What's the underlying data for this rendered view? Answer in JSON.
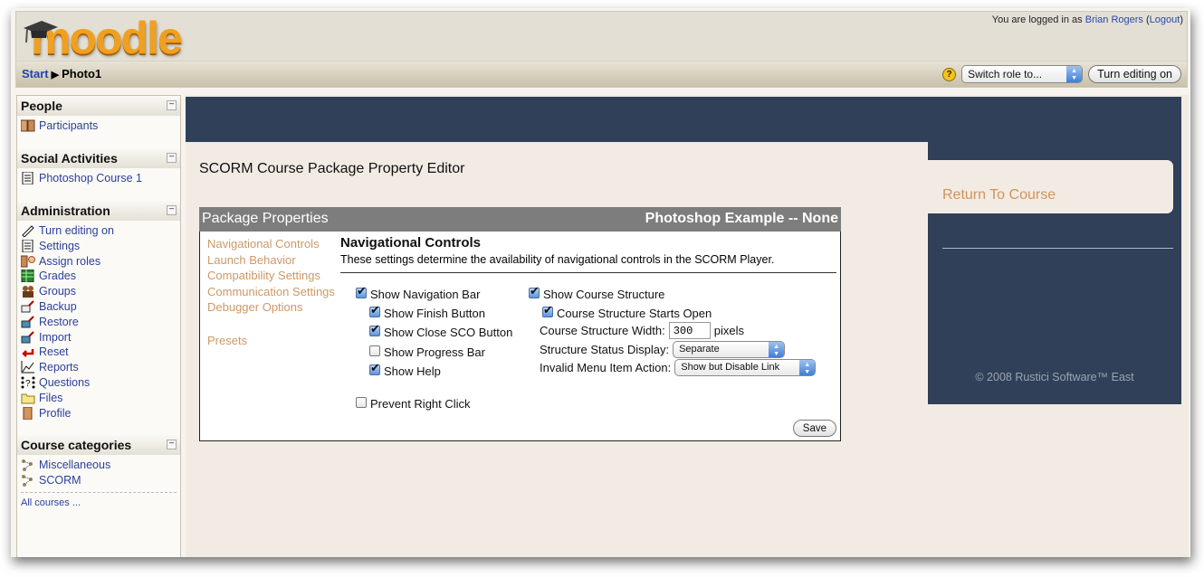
{
  "header": {
    "logo_text": "moodle",
    "login_prefix": "You are logged in as",
    "user_name": "Brian Rogers",
    "logout_label": "Logout"
  },
  "navbar": {
    "breadcrumb": [
      {
        "label": "Start",
        "link": true
      },
      {
        "label": "Photo1",
        "link": false
      }
    ],
    "separator": "▶",
    "help_icon": "?",
    "switch_role": {
      "selected": "Switch role to..."
    },
    "editing_button": "Turn editing on"
  },
  "sidebar": {
    "blocks": [
      {
        "title": "People",
        "items": [
          {
            "label": "Participants",
            "icon": "participants-icon"
          }
        ]
      },
      {
        "title": "Social Activities",
        "items": [
          {
            "label": "Photoshop Course 1",
            "icon": "document-icon"
          }
        ]
      },
      {
        "title": "Administration",
        "items": [
          {
            "label": "Turn editing on",
            "icon": "edit-icon"
          },
          {
            "label": "Settings",
            "icon": "settings-icon"
          },
          {
            "label": "Assign roles",
            "icon": "roles-icon"
          },
          {
            "label": "Grades",
            "icon": "grades-icon"
          },
          {
            "label": "Groups",
            "icon": "groups-icon"
          },
          {
            "label": "Backup",
            "icon": "backup-icon"
          },
          {
            "label": "Restore",
            "icon": "restore-icon"
          },
          {
            "label": "Import",
            "icon": "import-icon"
          },
          {
            "label": "Reset",
            "icon": "reset-icon"
          },
          {
            "label": "Reports",
            "icon": "reports-icon"
          },
          {
            "label": "Questions",
            "icon": "questions-icon"
          },
          {
            "label": "Files",
            "icon": "folder-icon"
          },
          {
            "label": "Profile",
            "icon": "profile-icon"
          }
        ]
      },
      {
        "title": "Course categories",
        "items": [
          {
            "label": "Miscellaneous",
            "icon": "category-icon"
          },
          {
            "label": "SCORM",
            "icon": "category-icon"
          }
        ],
        "footer_link": "All courses ..."
      }
    ]
  },
  "main": {
    "page_title": "SCORM Course Package Property Editor",
    "package": {
      "header_left": "Package Properties",
      "header_right": "Photoshop Example -- None",
      "nav": [
        "Navigational Controls",
        "Launch Behavior",
        "Compatibility Settings",
        "Communication Settings",
        "Debugger Options",
        "Presets"
      ],
      "pane_title": "Navigational Controls",
      "pane_desc": "These settings determine the availability of navigational controls in the SCORM Player.",
      "left_options": [
        {
          "label": "Show Navigation Bar",
          "checked": true
        },
        {
          "label": "Show Finish Button",
          "checked": true
        },
        {
          "label": "Show Close SCO Button",
          "checked": true
        },
        {
          "label": "Show Progress Bar",
          "checked": false
        },
        {
          "label": "Show Help",
          "checked": true
        },
        {
          "label": "Prevent Right Click",
          "checked": false
        }
      ],
      "right_options": [
        {
          "label": "Show Course Structure",
          "checked": true
        },
        {
          "label": "Course Structure Starts Open",
          "checked": true
        }
      ],
      "width_label": "Course Structure Width:",
      "width_value": "300",
      "width_unit": "pixels",
      "status_label": "Structure Status Display:",
      "status_value": "Separate",
      "invalid_label": "Invalid Menu Item Action:",
      "invalid_value": "Show but Disable Link",
      "save_label": "Save"
    },
    "right_panel": {
      "return_link": "Return To Course",
      "copyright": "© 2008 Rustici Software™ East"
    }
  }
}
